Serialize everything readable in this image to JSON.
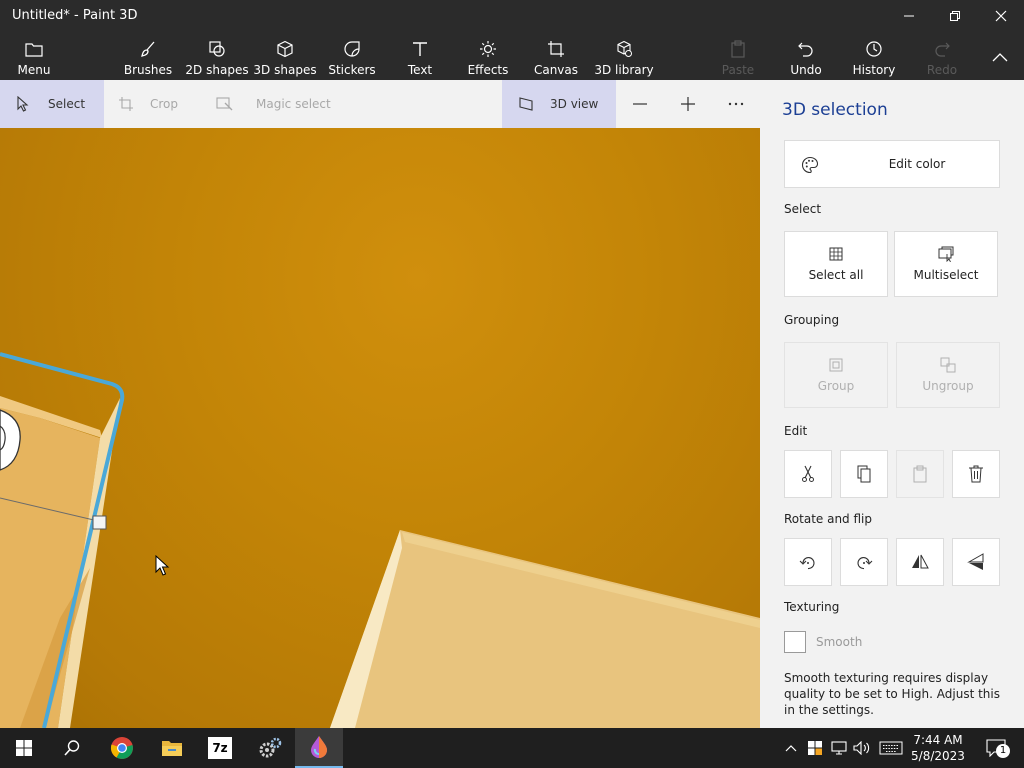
{
  "window": {
    "title": "Untitled* - Paint 3D"
  },
  "ribbon": {
    "menu": "Menu",
    "brushes": "Brushes",
    "shapes2d": "2D shapes",
    "shapes3d": "3D shapes",
    "stickers": "Stickers",
    "text": "Text",
    "effects": "Effects",
    "canvas": "Canvas",
    "library3d": "3D library",
    "paste": "Paste",
    "undo": "Undo",
    "history": "History",
    "redo": "Redo"
  },
  "toolstrip": {
    "select": "Select",
    "crop": "Crop",
    "magic_select": "Magic select",
    "view3d": "3D view"
  },
  "panel": {
    "title": "3D selection",
    "edit_color": "Edit color",
    "select_heading": "Select",
    "select_all": "Select all",
    "multiselect": "Multiselect",
    "grouping_heading": "Grouping",
    "group": "Group",
    "ungroup": "Ungroup",
    "edit_heading": "Edit",
    "rotate_heading": "Rotate and flip",
    "texturing_heading": "Texturing",
    "smooth": "Smooth",
    "smooth_note": "Smooth texturing requires display quality to be set to High. Adjust this in the settings."
  },
  "taskbar": {
    "time": "7:44 AM",
    "date": "5/8/2023",
    "notification_count": "1",
    "sevenzip_label": "7z"
  },
  "colors": {
    "accent": "#1c3f94",
    "canvas_bg": "#c38507",
    "selection_outline": "#4aa8d8"
  }
}
